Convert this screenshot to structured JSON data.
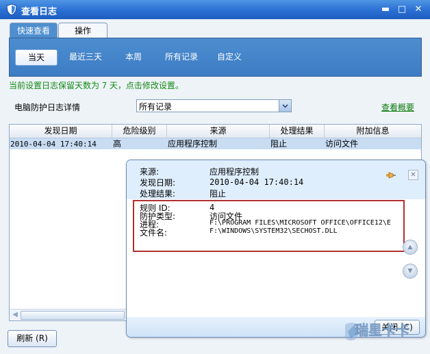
{
  "window": {
    "title": "查看日志",
    "minimize": "▬",
    "maximize": "□",
    "close": "✕"
  },
  "tabs": [
    {
      "label": "快速查看",
      "active": true
    },
    {
      "label": "操作",
      "active": false
    }
  ],
  "filters": [
    {
      "label": "当天",
      "selected": true
    },
    {
      "label": "最近三天",
      "selected": false
    },
    {
      "label": "本周",
      "selected": false
    },
    {
      "label": "所有记录",
      "selected": false
    },
    {
      "label": "自定义",
      "selected": false
    }
  ],
  "notice": {
    "prefix": "当前设置日志保留天数为",
    "days": "7",
    "suffix": "天，点击修改设置。"
  },
  "detail": {
    "label": "电脑防护日志详情",
    "select_value": "所有记录",
    "overview_link": "查看概要"
  },
  "table": {
    "columns": [
      "发现日期",
      "危险级别",
      "来源",
      "处理结果",
      "附加信息"
    ],
    "rows": [
      [
        "2010-04-04 17:40:14",
        "高",
        "应用程序控制",
        "阻止",
        "访问文件"
      ]
    ]
  },
  "refresh_button": "刷新 (R)",
  "popup": {
    "head": [
      {
        "key": "来源:",
        "value": "应用程序控制"
      },
      {
        "key": "发现日期:",
        "value": "2010-04-04 17:40:14"
      },
      {
        "key": "处理结果:",
        "value": "阻止"
      }
    ],
    "details": [
      {
        "key": "规则 ID:",
        "value": "4"
      },
      {
        "key": "防护类型:",
        "value": "访问文件"
      },
      {
        "key": "进程:",
        "value": "F:\\PROGRAM FILES\\MICROSOFT OFFICE\\OFFICE12\\E"
      },
      {
        "key": "文件名:",
        "value": "F:\\WINDOWS\\SYSTEM32\\SECHOST.DLL"
      }
    ],
    "close_button": "关闭 (C)"
  },
  "watermark": "瑞星卡卡",
  "colors": {
    "title_bar": "#2a6fd3",
    "filter_panel": "#4d8dcf",
    "selected_row": "#c8dcf2",
    "notice_green": "#138a13",
    "highlight_red": "#b0302e",
    "popup_head": "#dfeefd"
  },
  "icons": {
    "app": "shield-icon",
    "pin": "pin-icon",
    "popup_close": "close-icon",
    "scroll_up": "chevron-up-icon",
    "scroll_down": "chevron-down-icon"
  }
}
